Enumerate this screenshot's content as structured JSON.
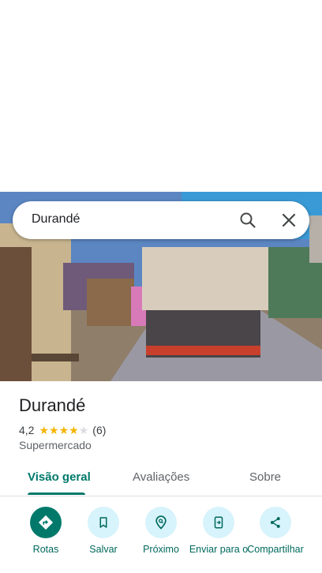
{
  "search": {
    "value": "Durandé"
  },
  "place": {
    "name": "Durandé",
    "rating": "4,2",
    "stars": 4,
    "reviews_count": "(6)",
    "category": "Supermercado"
  },
  "tabs": [
    {
      "label": "Visão geral"
    },
    {
      "label": "Avaliações"
    },
    {
      "label": "Sobre"
    }
  ],
  "actions": [
    {
      "label": "Rotas"
    },
    {
      "label": "Salvar"
    },
    {
      "label": "Próximo"
    },
    {
      "label": "Enviar para o"
    },
    {
      "label": "Compartilhar"
    }
  ],
  "colors": {
    "accent": "#00796b",
    "action_bg": "#d7f3fb",
    "star": "#f4b400"
  }
}
